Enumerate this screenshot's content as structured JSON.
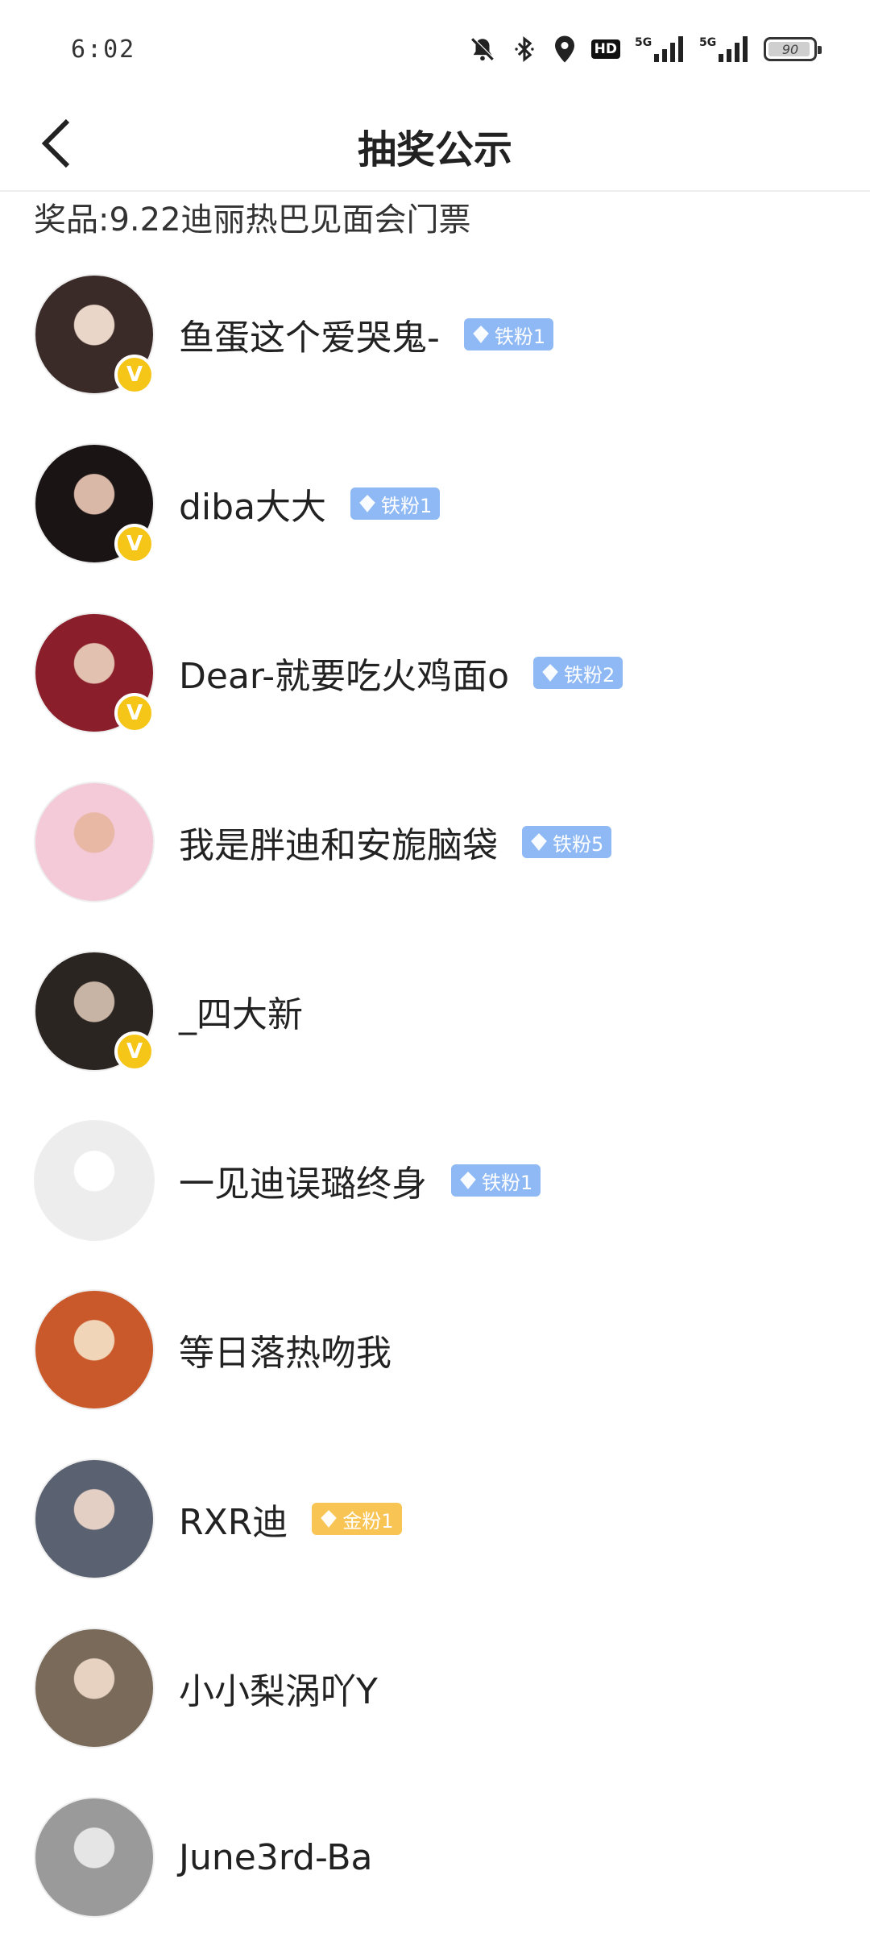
{
  "status_bar": {
    "time": "6:02",
    "network_1": "5G",
    "network_2": "5G",
    "hd_label": "HD",
    "battery_level": "90"
  },
  "nav": {
    "title": "抽奖公示"
  },
  "prize_text": "奖品:9.22迪丽热巴见面会门票",
  "winners": [
    {
      "name": "鱼蛋这个爱哭鬼-",
      "verified": true,
      "badge": {
        "label": "铁粉1",
        "type": "iron"
      },
      "avatar_colors": [
        "#3a2a28",
        "#e9d6c8"
      ]
    },
    {
      "name": "diba大大",
      "verified": true,
      "badge": {
        "label": "铁粉1",
        "type": "iron"
      },
      "avatar_colors": [
        "#1a1414",
        "#d9b8a8"
      ]
    },
    {
      "name": "Dear-就要吃火鸡面o",
      "verified": true,
      "badge": {
        "label": "铁粉2",
        "type": "iron"
      },
      "avatar_colors": [
        "#8a1e2a",
        "#e3c1b0"
      ]
    },
    {
      "name": "我是胖迪和安旎脑袋",
      "verified": false,
      "badge": {
        "label": "铁粉5",
        "type": "iron"
      },
      "avatar_colors": [
        "#f4c9d8",
        "#e8b8a5"
      ]
    },
    {
      "name": "_四大新",
      "verified": true,
      "badge": null,
      "avatar_colors": [
        "#2b2522",
        "#c8b4a4"
      ]
    },
    {
      "name": "一见迪误璐终身",
      "verified": false,
      "badge": {
        "label": "铁粉1",
        "type": "iron"
      },
      "avatar_colors": [
        "#ededed",
        "#ffffff"
      ]
    },
    {
      "name": "等日落热吻我",
      "verified": false,
      "badge": null,
      "avatar_colors": [
        "#c9582a",
        "#f1d5b8"
      ]
    },
    {
      "name": "RXR迪",
      "verified": false,
      "badge": {
        "label": "金粉1",
        "type": "gold"
      },
      "avatar_colors": [
        "#5a6170",
        "#e3cfc4"
      ]
    },
    {
      "name": "小小梨涡吖Y",
      "verified": false,
      "badge": null,
      "avatar_colors": [
        "#7a6a5a",
        "#e7d2c2"
      ]
    },
    {
      "name": "June3rd-Ba",
      "verified": false,
      "badge": null,
      "avatar_colors": [
        "#9a9a9a",
        "#e5e5e5"
      ]
    }
  ],
  "colors": {
    "iron_badge": "#8fb9f5",
    "gold_badge": "#f8c453",
    "verified": "#f5c518"
  }
}
